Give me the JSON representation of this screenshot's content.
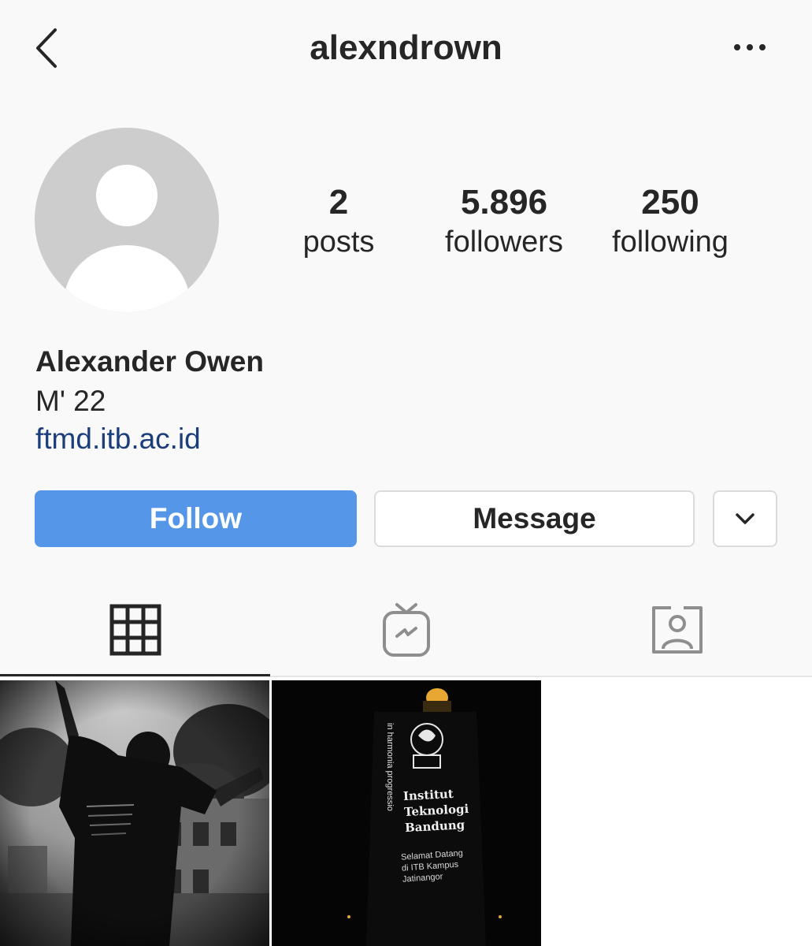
{
  "header": {
    "username": "alexndrown",
    "back_icon": "chevron-left-icon",
    "more_icon": "more-horizontal-icon"
  },
  "profile": {
    "avatar_icon": "default-avatar-icon",
    "stats": [
      {
        "value": "2",
        "label": "posts"
      },
      {
        "value": "5.896",
        "label": "followers"
      },
      {
        "value": "250",
        "label": "following"
      }
    ],
    "full_name": "Alexander Owen",
    "bio": "M' 22",
    "website": "ftmd.itb.ac.id"
  },
  "actions": {
    "follow_label": "Follow",
    "message_label": "Message",
    "dropdown_icon": "chevron-down-icon"
  },
  "tabs": [
    {
      "icon": "grid-icon",
      "active": true
    },
    {
      "icon": "igtv-icon",
      "active": false
    },
    {
      "icon": "tagged-user-icon",
      "active": false
    }
  ],
  "posts": [
    {
      "description_icon": "photo-thumbnail"
    },
    {
      "description_icon": "photo-thumbnail",
      "vertical_text": "in harmonia progressio",
      "title_lines": [
        "Institut",
        "Teknologi",
        "Bandung"
      ],
      "welcome_lines": [
        "Selamat Datang",
        "di ITB Kampus",
        "Jatinangor"
      ]
    }
  ],
  "colors": {
    "follow_blue": "#5596e8",
    "link_blue": "#1b3e7a",
    "background": "#f9f9f9",
    "text": "#262626"
  }
}
